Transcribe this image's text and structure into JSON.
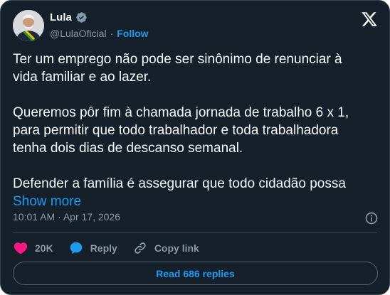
{
  "author": {
    "name": "Lula",
    "handle": "@LulaOficial",
    "separator": "·",
    "follow_label": "Follow"
  },
  "icons": {
    "verified": "verified-badge-icon",
    "logo": "x-logo-icon",
    "info": "info-icon",
    "like": "heart-icon",
    "reply": "reply-bubble-icon",
    "copy": "link-icon"
  },
  "colors": {
    "background": "#15202b",
    "accent": "#1d9bf0",
    "like": "#f91880",
    "text": "#f7f9f9",
    "muted": "#8b98a5",
    "border": "#38444d"
  },
  "tweet": {
    "text": "Ter um emprego não pode ser sinônimo de renunciar à vida familiar e ao lazer.\n\nQueremos pôr fim à chamada jornada de trabalho 6 x 1, para permitir que todo trabalhador e toda trabalhadora tenha dois dias de descanso semanal.\n\nDefender a família é assegurar que todo cidadão possa",
    "show_more": "Show more",
    "timestamp": "10:01 AM · Apr 17, 2026"
  },
  "actions": {
    "likes": "20K",
    "reply_label": "Reply",
    "copy_link_label": "Copy link"
  },
  "replies_button": "Read 686 replies"
}
